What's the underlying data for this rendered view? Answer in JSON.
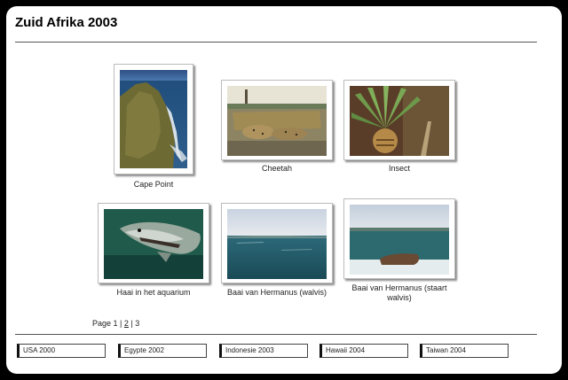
{
  "header": {
    "title": "Zuid Afrika 2003"
  },
  "gallery": {
    "items": [
      {
        "caption": "Cape Point"
      },
      {
        "caption": "Cheetah"
      },
      {
        "caption": "Insect"
      },
      {
        "caption": "Haai in het aquarium"
      },
      {
        "caption": "Baai van Hermanus (walvis)"
      },
      {
        "caption": "Baai van Hermanus (staart walvis)"
      }
    ]
  },
  "pagination": {
    "prefix": "Page 1",
    "sep1": "|",
    "page2": "2",
    "sep2": "|",
    "page3": "3"
  },
  "nav": {
    "items": [
      {
        "label": "USA 2000"
      },
      {
        "label": "Egypte 2002"
      },
      {
        "label": "Indonesie 2003"
      },
      {
        "label": "Hawaii 2004"
      },
      {
        "label": "Taiwan 2004"
      }
    ]
  }
}
